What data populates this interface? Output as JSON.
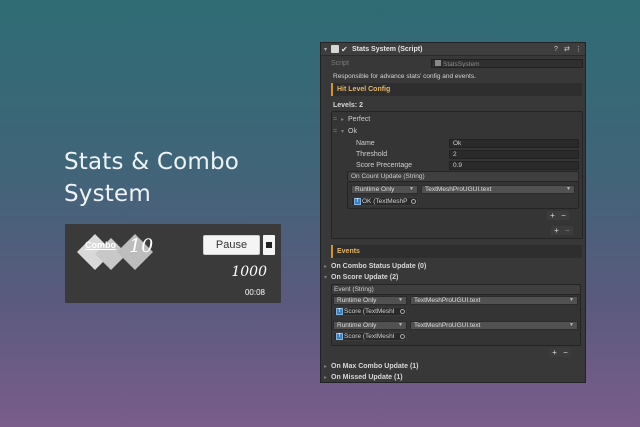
{
  "hero": {
    "title_line1": "Stats & Combo",
    "title_line2": "System"
  },
  "game": {
    "combo_label": "Combo",
    "combo_count": "10",
    "pause_label": "Pause",
    "score": "1000",
    "timer": "00:08"
  },
  "inspector": {
    "component_title": "Stats System (Script)",
    "script_label": "Script",
    "script_value": "StatsSystem",
    "description": "Responsible for advance stats' config and events.",
    "hit_level_header": "Hit Level Config",
    "levels_label": "Levels: 2",
    "level_perfect": "Perfect",
    "level_ok": "Ok",
    "ok_fields": [
      {
        "label": "Name",
        "value": "Ok"
      },
      {
        "label": "Threshold",
        "value": "2"
      },
      {
        "label": "Score Precentage",
        "value": "0.9"
      }
    ],
    "on_count_update_label": "On Count Update (String)",
    "runtime_only": "Runtime Only",
    "textmesh_text": "TextMeshProUGUI.text",
    "ok_object": "OK (TextMeshP",
    "events_header": "Events",
    "on_combo_status": "On Combo Status Update (0)",
    "on_score_update": "On Score Update (2)",
    "event_string": "Event (String)",
    "score_object": "Score (TextMeshI",
    "on_max_combo": "On Max Combo Update (1)",
    "on_missed": "On Missed Update (1)",
    "plus": "+",
    "minus": "−"
  },
  "colors": {
    "accent": "#d0922a",
    "panel": "#383838",
    "game_bg": "#3a3a3a"
  }
}
